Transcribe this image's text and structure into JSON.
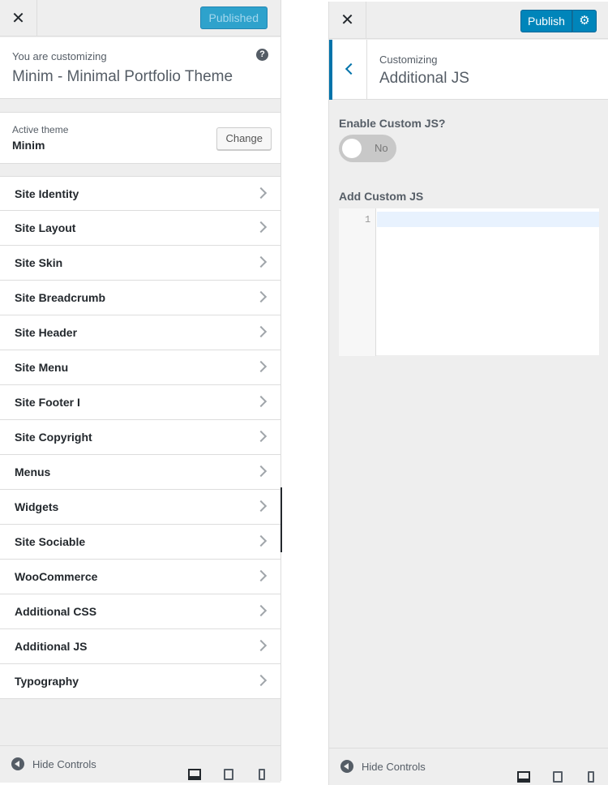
{
  "left_panel": {
    "close_icon": "close-icon",
    "published_label": "Published",
    "customizing_label": "You are customizing",
    "theme_title": "Minim - Minimal Portfolio Theme",
    "help_icon": "?",
    "active_theme_label": "Active theme",
    "active_theme_name": "Minim",
    "change_label": "Change",
    "items": [
      {
        "label": "Site Identity"
      },
      {
        "label": "Site Layout"
      },
      {
        "label": "Site Skin"
      },
      {
        "label": "Site Breadcrumb"
      },
      {
        "label": "Site Header"
      },
      {
        "label": "Site Menu"
      },
      {
        "label": "Site Footer I"
      },
      {
        "label": "Site Copyright"
      },
      {
        "label": "Menus"
      },
      {
        "label": "Widgets"
      },
      {
        "label": "Site Sociable"
      },
      {
        "label": "WooCommerce"
      },
      {
        "label": "Additional CSS"
      },
      {
        "label": "Additional JS"
      },
      {
        "label": "Typography"
      }
    ],
    "footer": {
      "hide_label": "Hide Controls"
    }
  },
  "right_panel": {
    "publish_label": "Publish",
    "gear_glyph": "⚙",
    "section_sub": "Customizing",
    "section_title": "Additional JS",
    "enable_label": "Enable Custom JS?",
    "toggle_state": "No",
    "add_label": "Add Custom JS",
    "editor_line_number": "1",
    "footer": {
      "hide_label": "Hide Controls"
    }
  },
  "colors": {
    "primary": "#0085ba",
    "accent": "#0073aa",
    "published_disabled": "#2ea2cc"
  }
}
